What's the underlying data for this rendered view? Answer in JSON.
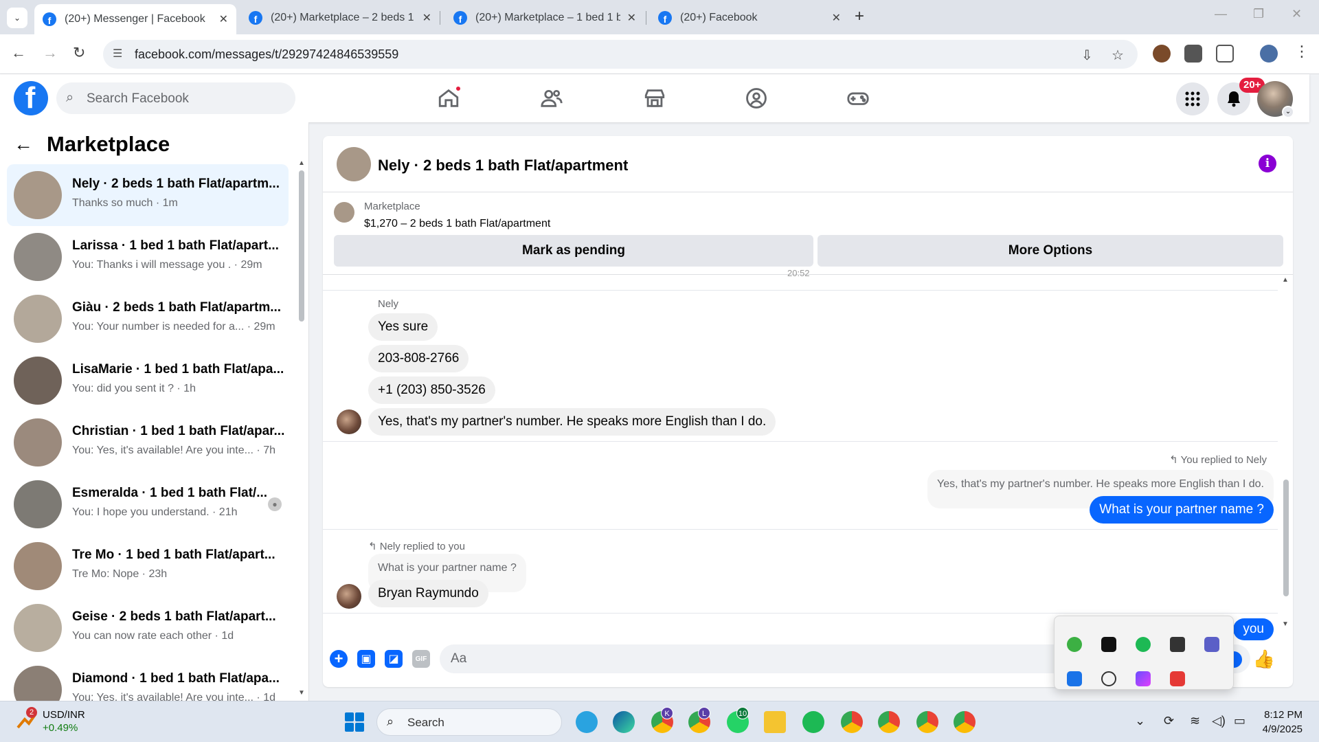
{
  "browser": {
    "tabs": [
      {
        "title": "(20+) Messenger | Facebook",
        "active": true
      },
      {
        "title": "(20+) Marketplace – 2 beds 1 b",
        "active": false
      },
      {
        "title": "(20+) Marketplace – 1 bed 1 ba",
        "active": false
      },
      {
        "title": "(20+) Facebook",
        "active": false
      }
    ],
    "url": "facebook.com/messages/t/29297424846539559"
  },
  "fb": {
    "search_placeholder": "Search Facebook",
    "notifications_badge": "20+"
  },
  "sidebar": {
    "title": "Marketplace",
    "conversations": [
      {
        "name": "Nely · 2 beds 1 bath Flat/apartm...",
        "preview": "Thanks so much · 1m",
        "active": true,
        "thumb": "#a89888"
      },
      {
        "name": "Larissa · 1 bed 1 bath Flat/apart...",
        "preview": "You: Thanks i will message you . · 29m",
        "active": false,
        "thumb": "#8f8a84"
      },
      {
        "name": "Giàu · 2 beds 1 bath Flat/apartm...",
        "preview": "You: Your number is needed for a... · 29m",
        "active": false,
        "thumb": "#b3a89a"
      },
      {
        "name": "LisaMarie · 1 bed 1 bath Flat/apa...",
        "preview": "You: did you sent it ? · 1h",
        "active": false,
        "thumb": "#6f6259"
      },
      {
        "name": "Christian · 1 bed 1 bath Flat/apar...",
        "preview": "You: Yes, it's available! Are you inte... · 7h",
        "active": false,
        "thumb": "#9b8a7d"
      },
      {
        "name": "Esmeralda · 1 bed 1 bath Flat/...",
        "preview": "You: I hope you understand. · 21h",
        "active": false,
        "thumb": "#7d7a74"
      },
      {
        "name": "Tre Mo · 1 bed 1 bath Flat/apart...",
        "preview": "Tre Mo: Nope · 23h",
        "active": false,
        "thumb": "#a08a78"
      },
      {
        "name": "Geise · 2 beds 1 bath Flat/apart...",
        "preview": "You can now rate each other · 1d",
        "active": false,
        "thumb": "#b8ae9f"
      },
      {
        "name": "Diamond · 1 bed 1 bath Flat/apa...",
        "preview": "You: Yes, it's available! Are you inte... · 1d",
        "active": false,
        "thumb": "#8b7f75"
      }
    ]
  },
  "chat": {
    "header_name": "Nely · 2 beds 1 bath Flat/apartment",
    "listing": {
      "source": "Marketplace",
      "description": "$1,270 – 2 beds 1 bath Flat/apartment",
      "mark_pending": "Mark as pending",
      "more_options": "More Options"
    },
    "timestamp_partial": "20:52",
    "sender": "Nely",
    "messages_in": [
      "Yes sure",
      "203-808-2766",
      "+1 (203) 850-3526",
      "Yes, that's my partner's number. He speaks more English than I do."
    ],
    "you_replied": "You replied to Nely",
    "quoted_in": "Yes, that's my partner's number. He speaks more English than I do.",
    "my_message": "What is your partner name ?",
    "nely_replied": "Nely replied to you",
    "quoted_out": "What is your partner name ?",
    "reply": "Bryan Raymundo",
    "partial_bottom": "you",
    "composer_placeholder": "Aa"
  },
  "taskbar": {
    "ticker_badge": "2",
    "ticker_name": "USD/INR",
    "ticker_change": "+0.49%",
    "search": "Search",
    "badges": [
      "K",
      "L",
      "10"
    ],
    "time": "8:12 PM",
    "date": "4/9/2025"
  },
  "colors": {
    "fb_blue": "#1877f2",
    "messenger_blue": "#0866ff",
    "active_conv": "#ebf5ff",
    "info_purple": "#8a00d4"
  }
}
